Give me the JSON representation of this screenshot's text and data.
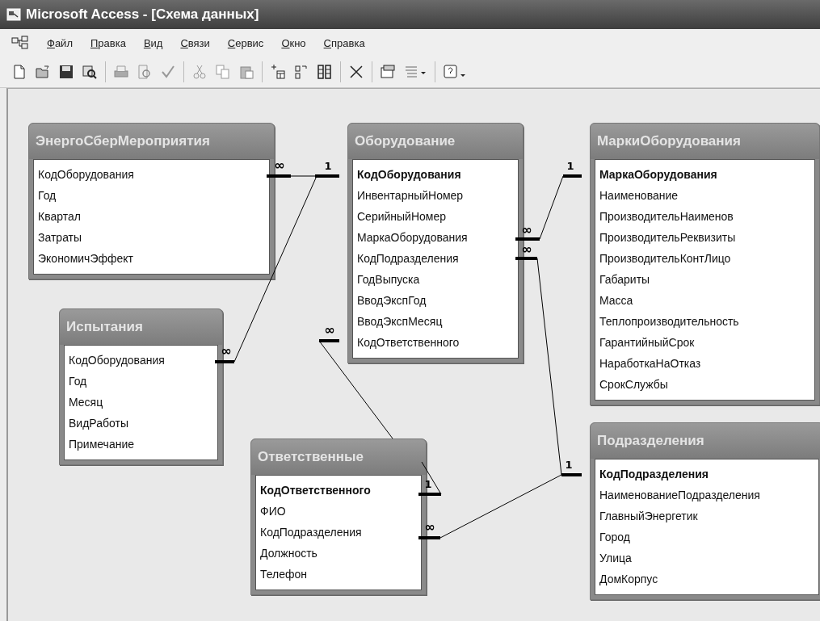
{
  "window": {
    "title": "Microsoft Access - [Схема данных]"
  },
  "menu": [
    "Файл",
    "Правка",
    "Вид",
    "Связи",
    "Сервис",
    "Окно",
    "Справка"
  ],
  "tables": [
    {
      "name": "ЭнергоСберМероприятия",
      "fields": [
        {
          "name": "КодОборудования",
          "key": false
        },
        {
          "name": "Год",
          "key": false
        },
        {
          "name": "Квартал",
          "key": false
        },
        {
          "name": "Затраты",
          "key": false
        },
        {
          "name": "ЭкономичЭффект",
          "key": false
        }
      ]
    },
    {
      "name": "Оборудование",
      "fields": [
        {
          "name": "КодОборудования",
          "key": true
        },
        {
          "name": "ИнвентарныйНомер",
          "key": false
        },
        {
          "name": "СерийныйНомер",
          "key": false
        },
        {
          "name": "МаркаОборудования",
          "key": false
        },
        {
          "name": "КодПодразделения",
          "key": false
        },
        {
          "name": "ГодВыпуска",
          "key": false
        },
        {
          "name": "ВводЭкспГод",
          "key": false
        },
        {
          "name": "ВводЭкспМесяц",
          "key": false
        },
        {
          "name": "КодОтветственного",
          "key": false
        }
      ]
    },
    {
      "name": "МаркиОборудования",
      "fields": [
        {
          "name": "МаркаОборудования",
          "key": true
        },
        {
          "name": "Наименование",
          "key": false
        },
        {
          "name": "ПроизводительНаименов",
          "key": false
        },
        {
          "name": "ПроизводительРеквизиты",
          "key": false
        },
        {
          "name": "ПроизводительКонтЛицо",
          "key": false
        },
        {
          "name": "Габариты",
          "key": false
        },
        {
          "name": "Масса",
          "key": false
        },
        {
          "name": "Теплопроизводительность",
          "key": false
        },
        {
          "name": "ГарантийныйСрок",
          "key": false
        },
        {
          "name": "НаработкаНаОтказ",
          "key": false
        },
        {
          "name": "СрокСлужбы",
          "key": false
        }
      ]
    },
    {
      "name": "Испытания",
      "fields": [
        {
          "name": "КодОборудования",
          "key": false
        },
        {
          "name": "Год",
          "key": false
        },
        {
          "name": "Месяц",
          "key": false
        },
        {
          "name": "ВидРаботы",
          "key": false
        },
        {
          "name": "Примечание",
          "key": false
        }
      ]
    },
    {
      "name": "Ответственные",
      "fields": [
        {
          "name": "КодОтветственного",
          "key": true
        },
        {
          "name": "ФИО",
          "key": false
        },
        {
          "name": "КодПодразделения",
          "key": false
        },
        {
          "name": "Должность",
          "key": false
        },
        {
          "name": "Телефон",
          "key": false
        }
      ]
    },
    {
      "name": "Подразделения",
      "fields": [
        {
          "name": "КодПодразделения",
          "key": true
        },
        {
          "name": "НаименованиеПодразделения",
          "key": false
        },
        {
          "name": "ГлавныйЭнергетик",
          "key": false
        },
        {
          "name": "Город",
          "key": false
        },
        {
          "name": "Улица",
          "key": false
        },
        {
          "name": "ДомКорпус",
          "key": false
        }
      ]
    }
  ],
  "relationships": [
    {
      "many_label": "∞",
      "one_label": "1"
    },
    {
      "many_label": "∞",
      "one_label": "1"
    },
    {
      "many_label": "∞",
      "one_label": "1"
    },
    {
      "many_label": "∞",
      "one_label": "1"
    },
    {
      "many_label": "∞"
    },
    {
      "many_label": "∞"
    }
  ]
}
